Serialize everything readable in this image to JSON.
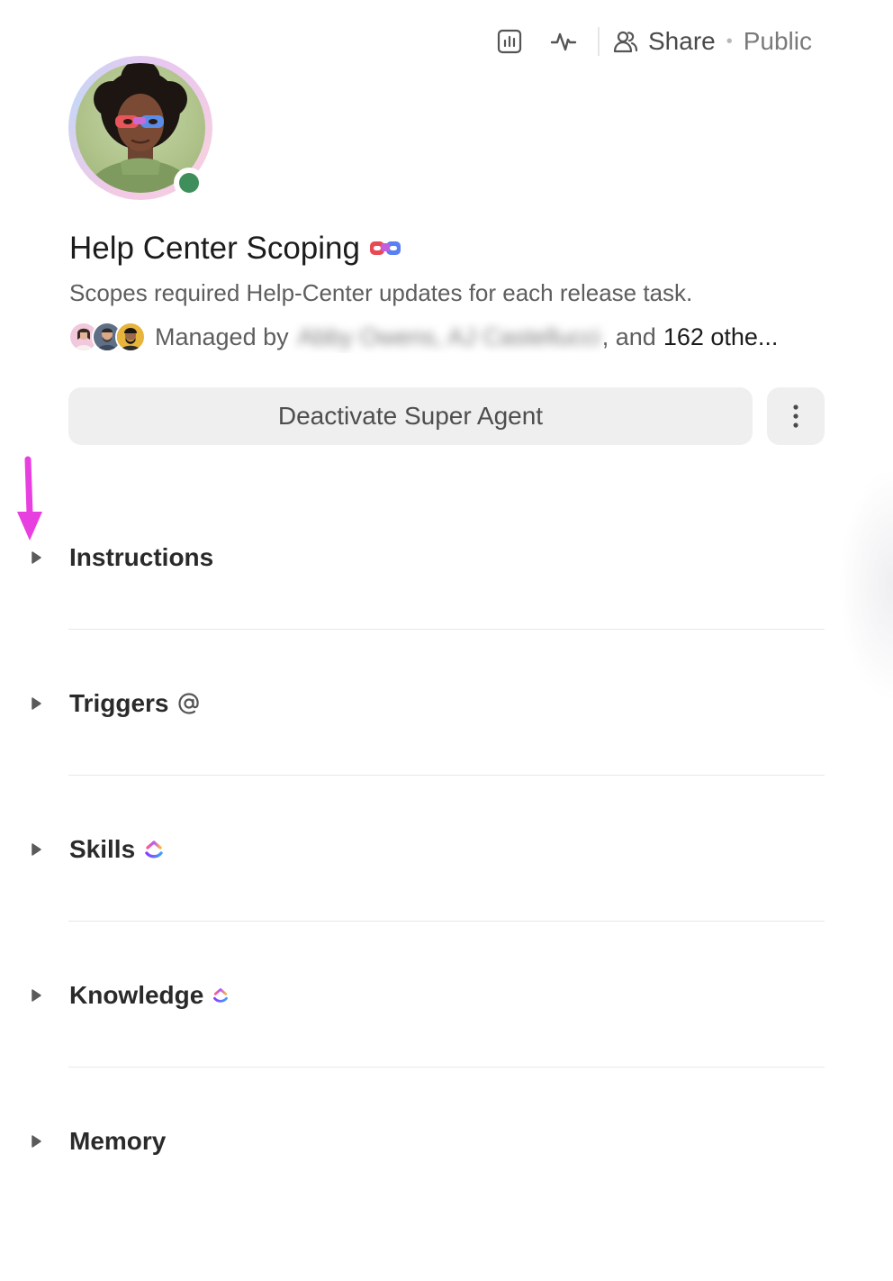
{
  "toolbar": {
    "analytics_icon": "bar-chart-icon",
    "activity_icon": "activity-icon",
    "share_label": "Share",
    "share_separator": "•",
    "visibility": "Public"
  },
  "agent": {
    "name": "Help Center Scoping",
    "description": "Scopes required Help-Center updates for each release task.",
    "status": "online",
    "status_color": "#3f8f5c"
  },
  "managers": {
    "prefix": "Managed by",
    "names_redacted": "Abby Owens, AJ Castellucci",
    "suffix": ", and",
    "others": "162 othe..."
  },
  "actions": {
    "deactivate_label": "Deactivate Super Agent",
    "more_icon": "more-vertical-icon"
  },
  "sections": [
    {
      "label": "Instructions",
      "icon": ""
    },
    {
      "label": "Triggers",
      "icon": "at-icon"
    },
    {
      "label": "Skills",
      "icon": "clickup-logo-icon"
    },
    {
      "label": "Knowledge",
      "icon": "clickup-logo-icon"
    },
    {
      "label": "Memory",
      "icon": ""
    }
  ],
  "colors": {
    "annotation_arrow": "#e83fe0",
    "button_bg": "#efefef"
  }
}
